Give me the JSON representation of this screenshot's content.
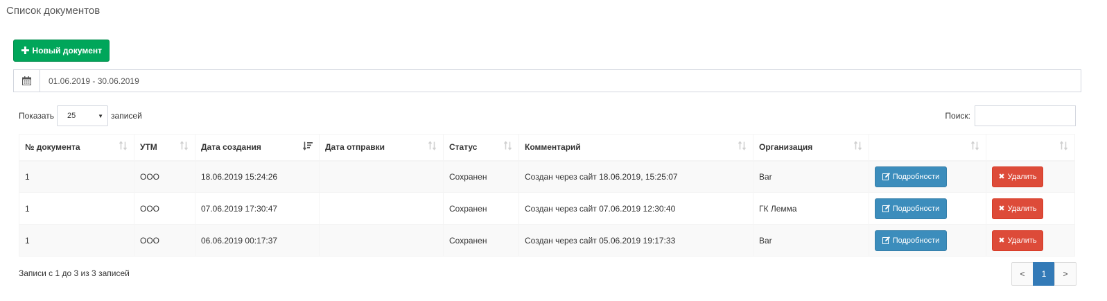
{
  "page": {
    "title": "Список документов"
  },
  "toolbar": {
    "new_button": "Новый документ",
    "new_icon": "plus-icon"
  },
  "daterange": {
    "value": "01.06.2019 - 30.06.2019",
    "icon": "calendar-icon"
  },
  "length_control": {
    "prefix": "Показать",
    "selected": "25",
    "suffix": "записей"
  },
  "search": {
    "label": "Поиск:",
    "value": ""
  },
  "table": {
    "columns": [
      "№ документа",
      "УТМ",
      "Дата создания",
      "Дата отправки",
      "Статус",
      "Комментарий",
      "Организация",
      "",
      ""
    ],
    "sorted_column": "Дата создания",
    "rows": [
      {
        "number": "1",
        "utm": "ООО",
        "created": "18.06.2019 15:24:26",
        "sent": "",
        "status": "Сохранен",
        "comment": "Создан через сайт 18.06.2019, 15:25:07",
        "organization": "Bar"
      },
      {
        "number": "1",
        "utm": "ООО",
        "created": "07.06.2019 17:30:47",
        "sent": "",
        "status": "Сохранен",
        "comment": "Создан через сайт 07.06.2019 12:30:40",
        "organization": "ГК Лемма"
      },
      {
        "number": "1",
        "utm": "ООО",
        "created": "06.06.2019 00:17:37",
        "sent": "",
        "status": "Сохранен",
        "comment": "Создан через сайт 05.06.2019 19:17:33",
        "organization": "Bar"
      }
    ],
    "details_label": "Подробности",
    "delete_label": "Удалить"
  },
  "footer": {
    "info": "Записи с 1 до 3 из 3 записей"
  },
  "pagination": {
    "prev": "<",
    "pages": [
      "1"
    ],
    "next": ">",
    "current": "1"
  },
  "colors": {
    "success": "#00a65a",
    "primary": "#3c8dbc",
    "danger": "#dd4b39",
    "active_page": "#337ab7"
  }
}
